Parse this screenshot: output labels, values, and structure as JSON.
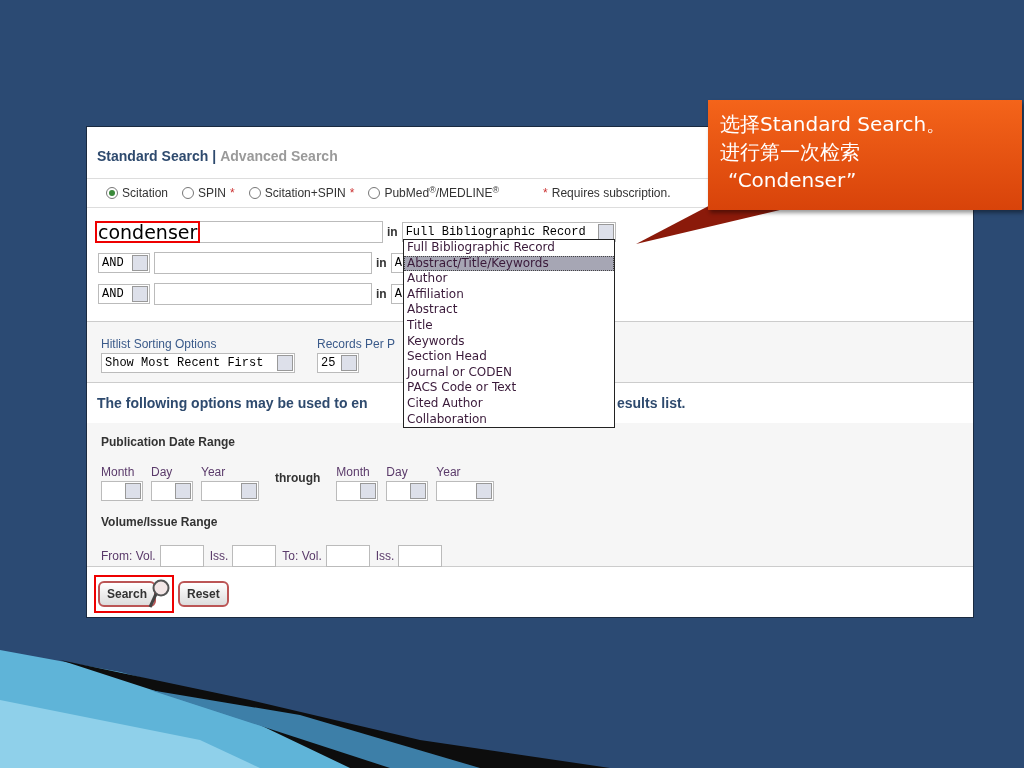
{
  "callout": {
    "lines": [
      "选择Standard Search。",
      "进行第一次检索",
      "“Condenser”"
    ]
  },
  "search_form": {
    "tabs": [
      {
        "label": "Standard Search",
        "selected": true
      },
      {
        "label": "Advanced Search",
        "selected": false
      }
    ],
    "tab_separator": "|",
    "databases": [
      {
        "label": "Scitation",
        "selected": true
      },
      {
        "label": "SPIN",
        "selected": false,
        "mark": "*"
      },
      {
        "label": "Scitation+SPIN",
        "selected": false,
        "mark": "*"
      },
      {
        "label": "PubMed$^{®}$/MEDLINE$^{®}$",
        "selected": false
      }
    ],
    "subscription_note": {
      "mark": "*",
      "text": "Requires subscription."
    },
    "query_rows": [
      {
        "value": "condenser",
        "highlighted": true,
        "in": "in",
        "field": "Full Bibliographic Record"
      },
      {
        "operator": "AND",
        "in": "in",
        "field": "A"
      },
      {
        "operator": "AND",
        "in": "in",
        "field": "A"
      }
    ],
    "field_menu": {
      "open": true,
      "options": [
        {
          "label": "Full Bibliographic Record",
          "selected": false
        },
        {
          "label": "Abstract/Title/Keywords",
          "selected": true
        },
        {
          "label": "Author",
          "selected": false
        },
        {
          "label": "Affiliation",
          "selected": false
        },
        {
          "label": "Abstract",
          "selected": false
        },
        {
          "label": "Title",
          "selected": false
        },
        {
          "label": "Keywords",
          "selected": false
        },
        {
          "label": "Section Head",
          "selected": false
        },
        {
          "label": "Journal or CODEN",
          "selected": false
        },
        {
          "label": "PACS Code or Text",
          "selected": false
        },
        {
          "label": "Cited Author",
          "selected": false
        },
        {
          "label": "Collaboration",
          "selected": false
        }
      ]
    },
    "sorting": {
      "label": "Hitlist Sorting Options",
      "value": "Show Most Recent First"
    },
    "records": {
      "label": "Records Per P",
      "value": "25"
    },
    "options_text": [
      "The following options may be used to en",
      "esults list."
    ],
    "date_range": {
      "title": "Publication Date Range",
      "from": [
        "Month",
        "Day",
        "Year"
      ],
      "through": "through",
      "to": [
        "Month",
        "Day",
        "Year"
      ]
    },
    "volume_range": {
      "title": "Volume/Issue Range",
      "fields": [
        "From: Vol.",
        "Iss.",
        "To: Vol.",
        "Iss."
      ]
    },
    "buttons": [
      {
        "label": "Search",
        "highlighted": true
      },
      {
        "label": "Reset",
        "highlighted": false
      }
    ]
  }
}
